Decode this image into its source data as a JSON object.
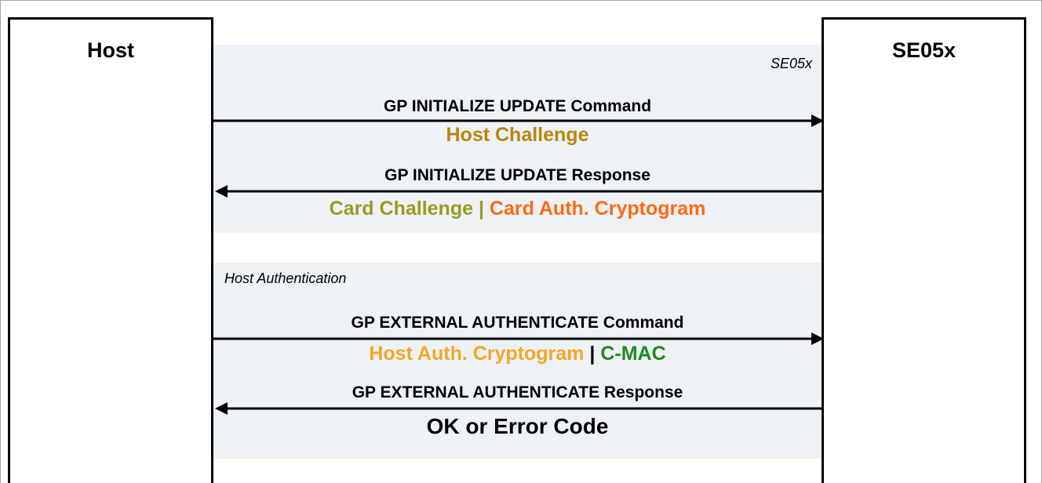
{
  "participants": {
    "host": "Host",
    "se": "SE05x"
  },
  "sections": [
    {
      "label": "SE05x"
    },
    {
      "label": "Host Authentication"
    }
  ],
  "messages": [
    {
      "title": "GP INITIALIZE UPDATE Command",
      "direction": "host-to-se",
      "payload": [
        {
          "text": "Host Challenge",
          "color": "#b8860b"
        }
      ]
    },
    {
      "title": "GP INITIALIZE UPDATE Response",
      "direction": "se-to-host",
      "payload": [
        {
          "text": "Card Challenge",
          "color": "#9a9a1e"
        },
        {
          "text": " | ",
          "color": "#9a9a1e"
        },
        {
          "text": "Card Auth. Cryptogram",
          "color": "#ff6a13"
        }
      ]
    },
    {
      "title": "GP EXTERNAL AUTHENTICATE Command",
      "direction": "host-to-se",
      "payload": [
        {
          "text": "Host Auth. Cryptogram",
          "color": "#f5a623"
        },
        {
          "text": " | ",
          "color": "#000000"
        },
        {
          "text": "C-MAC",
          "color": "#1e8a1e"
        }
      ]
    },
    {
      "title": "GP EXTERNAL AUTHENTICATE Response",
      "direction": "se-to-host",
      "payload": [
        {
          "text": "OK or Error Code",
          "color": "#000000"
        }
      ]
    }
  ]
}
